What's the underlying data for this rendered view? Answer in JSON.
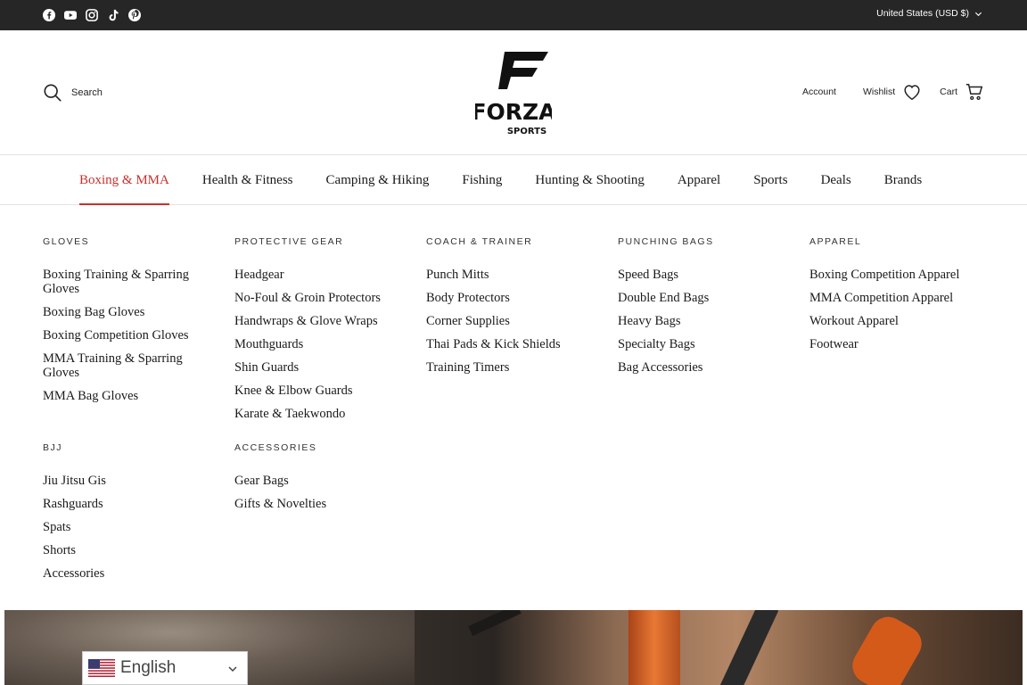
{
  "topbar": {
    "social_icons": [
      "facebook-icon",
      "youtube-icon",
      "instagram-icon",
      "tiktok-icon",
      "pinterest-icon"
    ],
    "currency": "United States (USD $)"
  },
  "header": {
    "search_label": "Search",
    "logo_text": "FORZA",
    "logo_subtext": "SPORTS",
    "account_label": "Account",
    "wishlist_label": "Wishlist",
    "cart_label": "Cart"
  },
  "nav": {
    "items": [
      {
        "label": "Boxing & MMA",
        "active": true
      },
      {
        "label": "Health & Fitness"
      },
      {
        "label": "Camping & Hiking"
      },
      {
        "label": "Fishing"
      },
      {
        "label": "Hunting & Shooting"
      },
      {
        "label": "Apparel"
      },
      {
        "label": "Sports"
      },
      {
        "label": "Deals"
      },
      {
        "label": "Brands"
      }
    ]
  },
  "mega": {
    "gloves": {
      "heading": "GLOVES",
      "links": [
        "Boxing Training & Sparring Gloves",
        "Boxing Bag Gloves",
        "Boxing Competition Gloves",
        "MMA Training & Sparring Gloves",
        "MMA Bag Gloves"
      ]
    },
    "protective": {
      "heading": "PROTECTIVE GEAR",
      "links": [
        "Headgear",
        "No-Foul & Groin Protectors",
        "Handwraps & Glove Wraps",
        "Mouthguards",
        "Shin Guards",
        "Knee & Elbow Guards",
        "Karate & Taekwondo"
      ]
    },
    "coach": {
      "heading": "COACH & TRAINER",
      "links": [
        "Punch Mitts",
        "Body Protectors",
        "Corner Supplies",
        "Thai Pads & Kick Shields",
        "Training Timers"
      ]
    },
    "bags": {
      "heading": "PUNCHING BAGS",
      "links": [
        "Speed Bags",
        "Double End Bags",
        "Heavy Bags",
        "Specialty Bags",
        "Bag Accessories"
      ]
    },
    "apparel": {
      "heading": "APPAREL",
      "links": [
        "Boxing Competition Apparel",
        "MMA Competition Apparel",
        "Workout Apparel",
        "Footwear"
      ]
    },
    "bjj": {
      "heading": "BJJ",
      "links": [
        "Jiu Jitsu Gis",
        "Rashguards",
        "Spats",
        "Shorts",
        "Accessories"
      ]
    },
    "accessories": {
      "heading": "ACCESSORIES",
      "links": [
        "Gear Bags",
        "Gifts & Novelties"
      ]
    }
  },
  "language": {
    "selected": "English",
    "flag_icon": "us-flag-icon"
  },
  "colors": {
    "accent": "#c8302c",
    "topbar": "#262626"
  }
}
